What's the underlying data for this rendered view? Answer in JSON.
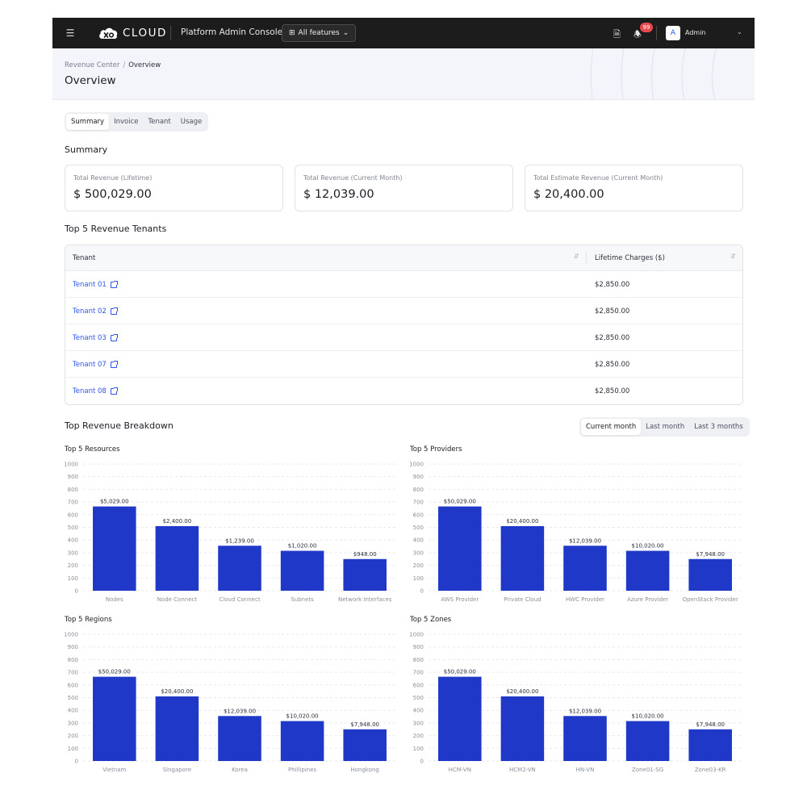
{
  "topbar": {
    "brand": "CLOUD",
    "console_title": "Platform Admin Console",
    "features_label": "All features",
    "notifications_count": "99",
    "avatar_letter": "A",
    "user_name": "Admin"
  },
  "header": {
    "breadcrumb": [
      "Revenue Center",
      "Overview"
    ],
    "title": "Overview"
  },
  "tabs": [
    "Summary",
    "Invoice",
    "Tenant",
    "Usage"
  ],
  "summary": {
    "title": "Summary",
    "cards": [
      {
        "label": "Total Revenue (Lifetime)",
        "value": "$ 500,029.00"
      },
      {
        "label": "Total Revenue (Current Month)",
        "value": "$ 12,039.00"
      },
      {
        "label": "Total Estimate Revenue (Current Month)",
        "value": "$ 20,400.00"
      }
    ]
  },
  "top_tenants": {
    "title": "Top 5 Revenue Tenants",
    "columns": [
      "Tenant",
      "Lifetime Charges ($)"
    ],
    "rows": [
      {
        "tenant": "Tenant 01",
        "charge": "$2,850.00"
      },
      {
        "tenant": "Tenant 02",
        "charge": "$2,850.00"
      },
      {
        "tenant": "Tenant 03",
        "charge": "$2,850.00"
      },
      {
        "tenant": "Tenant 07",
        "charge": "$2,850.00"
      },
      {
        "tenant": "Tenant 08",
        "charge": "$2,850.00"
      }
    ]
  },
  "breakdown": {
    "title": "Top Revenue Breakdown",
    "periods": [
      "Current month",
      "Last month",
      "Last 3 months"
    ],
    "active_period": "Current month"
  },
  "colors": {
    "accent": "#2f54eb",
    "bar": "#1f38c8"
  },
  "chart_data": [
    {
      "type": "bar",
      "title": "Top 5 Resources",
      "categories": [
        "Nodes",
        "Node Connect",
        "Cloud Connect",
        "Subnets",
        "Network Interfaces"
      ],
      "values": [
        665,
        510,
        355,
        315,
        250
      ],
      "data_labels": [
        "$5,029.00",
        "$2,400.00",
        "$1,239.00",
        "$1,020.00",
        "$948.00"
      ],
      "ylim": [
        0,
        1000
      ],
      "yticks": [
        0,
        100,
        200,
        300,
        400,
        500,
        600,
        700,
        800,
        900,
        1000
      ],
      "grid": true
    },
    {
      "type": "bar",
      "title": "Top 5 Providers",
      "categories": [
        "AWS Provider",
        "Private Cloud",
        "HWC Provider",
        "Azure Provider",
        "OpenStack Provider"
      ],
      "values": [
        665,
        510,
        355,
        315,
        250
      ],
      "data_labels": [
        "$50,029.00",
        "$20,400.00",
        "$12,039.00",
        "$10,020.00",
        "$7,948.00"
      ],
      "ylim": [
        0,
        1000
      ],
      "yticks": [
        0,
        100,
        200,
        300,
        400,
        500,
        600,
        700,
        800,
        900,
        1000
      ],
      "grid": true
    },
    {
      "type": "bar",
      "title": "Top 5 Regions",
      "categories": [
        "Vietnam",
        "Singapore",
        "Korea",
        "Phillipines",
        "Hongkong"
      ],
      "values": [
        665,
        510,
        355,
        315,
        250
      ],
      "data_labels": [
        "$50,029.00",
        "$20,400.00",
        "$12,039.00",
        "$10,020.00",
        "$7,948.00"
      ],
      "ylim": [
        0,
        1000
      ],
      "yticks": [
        0,
        100,
        200,
        300,
        400,
        500,
        600,
        700,
        800,
        900,
        1000
      ],
      "grid": true
    },
    {
      "type": "bar",
      "title": "Top 5 Zones",
      "categories": [
        "HCM-VN",
        "HCM2-VN",
        "HN-VN",
        "Zone01-SG",
        "Zone03-KR"
      ],
      "values": [
        665,
        510,
        355,
        315,
        250
      ],
      "data_labels": [
        "$50,029.00",
        "$20,400.00",
        "$12,039.00",
        "$10,020.00",
        "$7,948.00"
      ],
      "ylim": [
        0,
        1000
      ],
      "yticks": [
        0,
        100,
        200,
        300,
        400,
        500,
        600,
        700,
        800,
        900,
        1000
      ],
      "grid": true
    }
  ]
}
